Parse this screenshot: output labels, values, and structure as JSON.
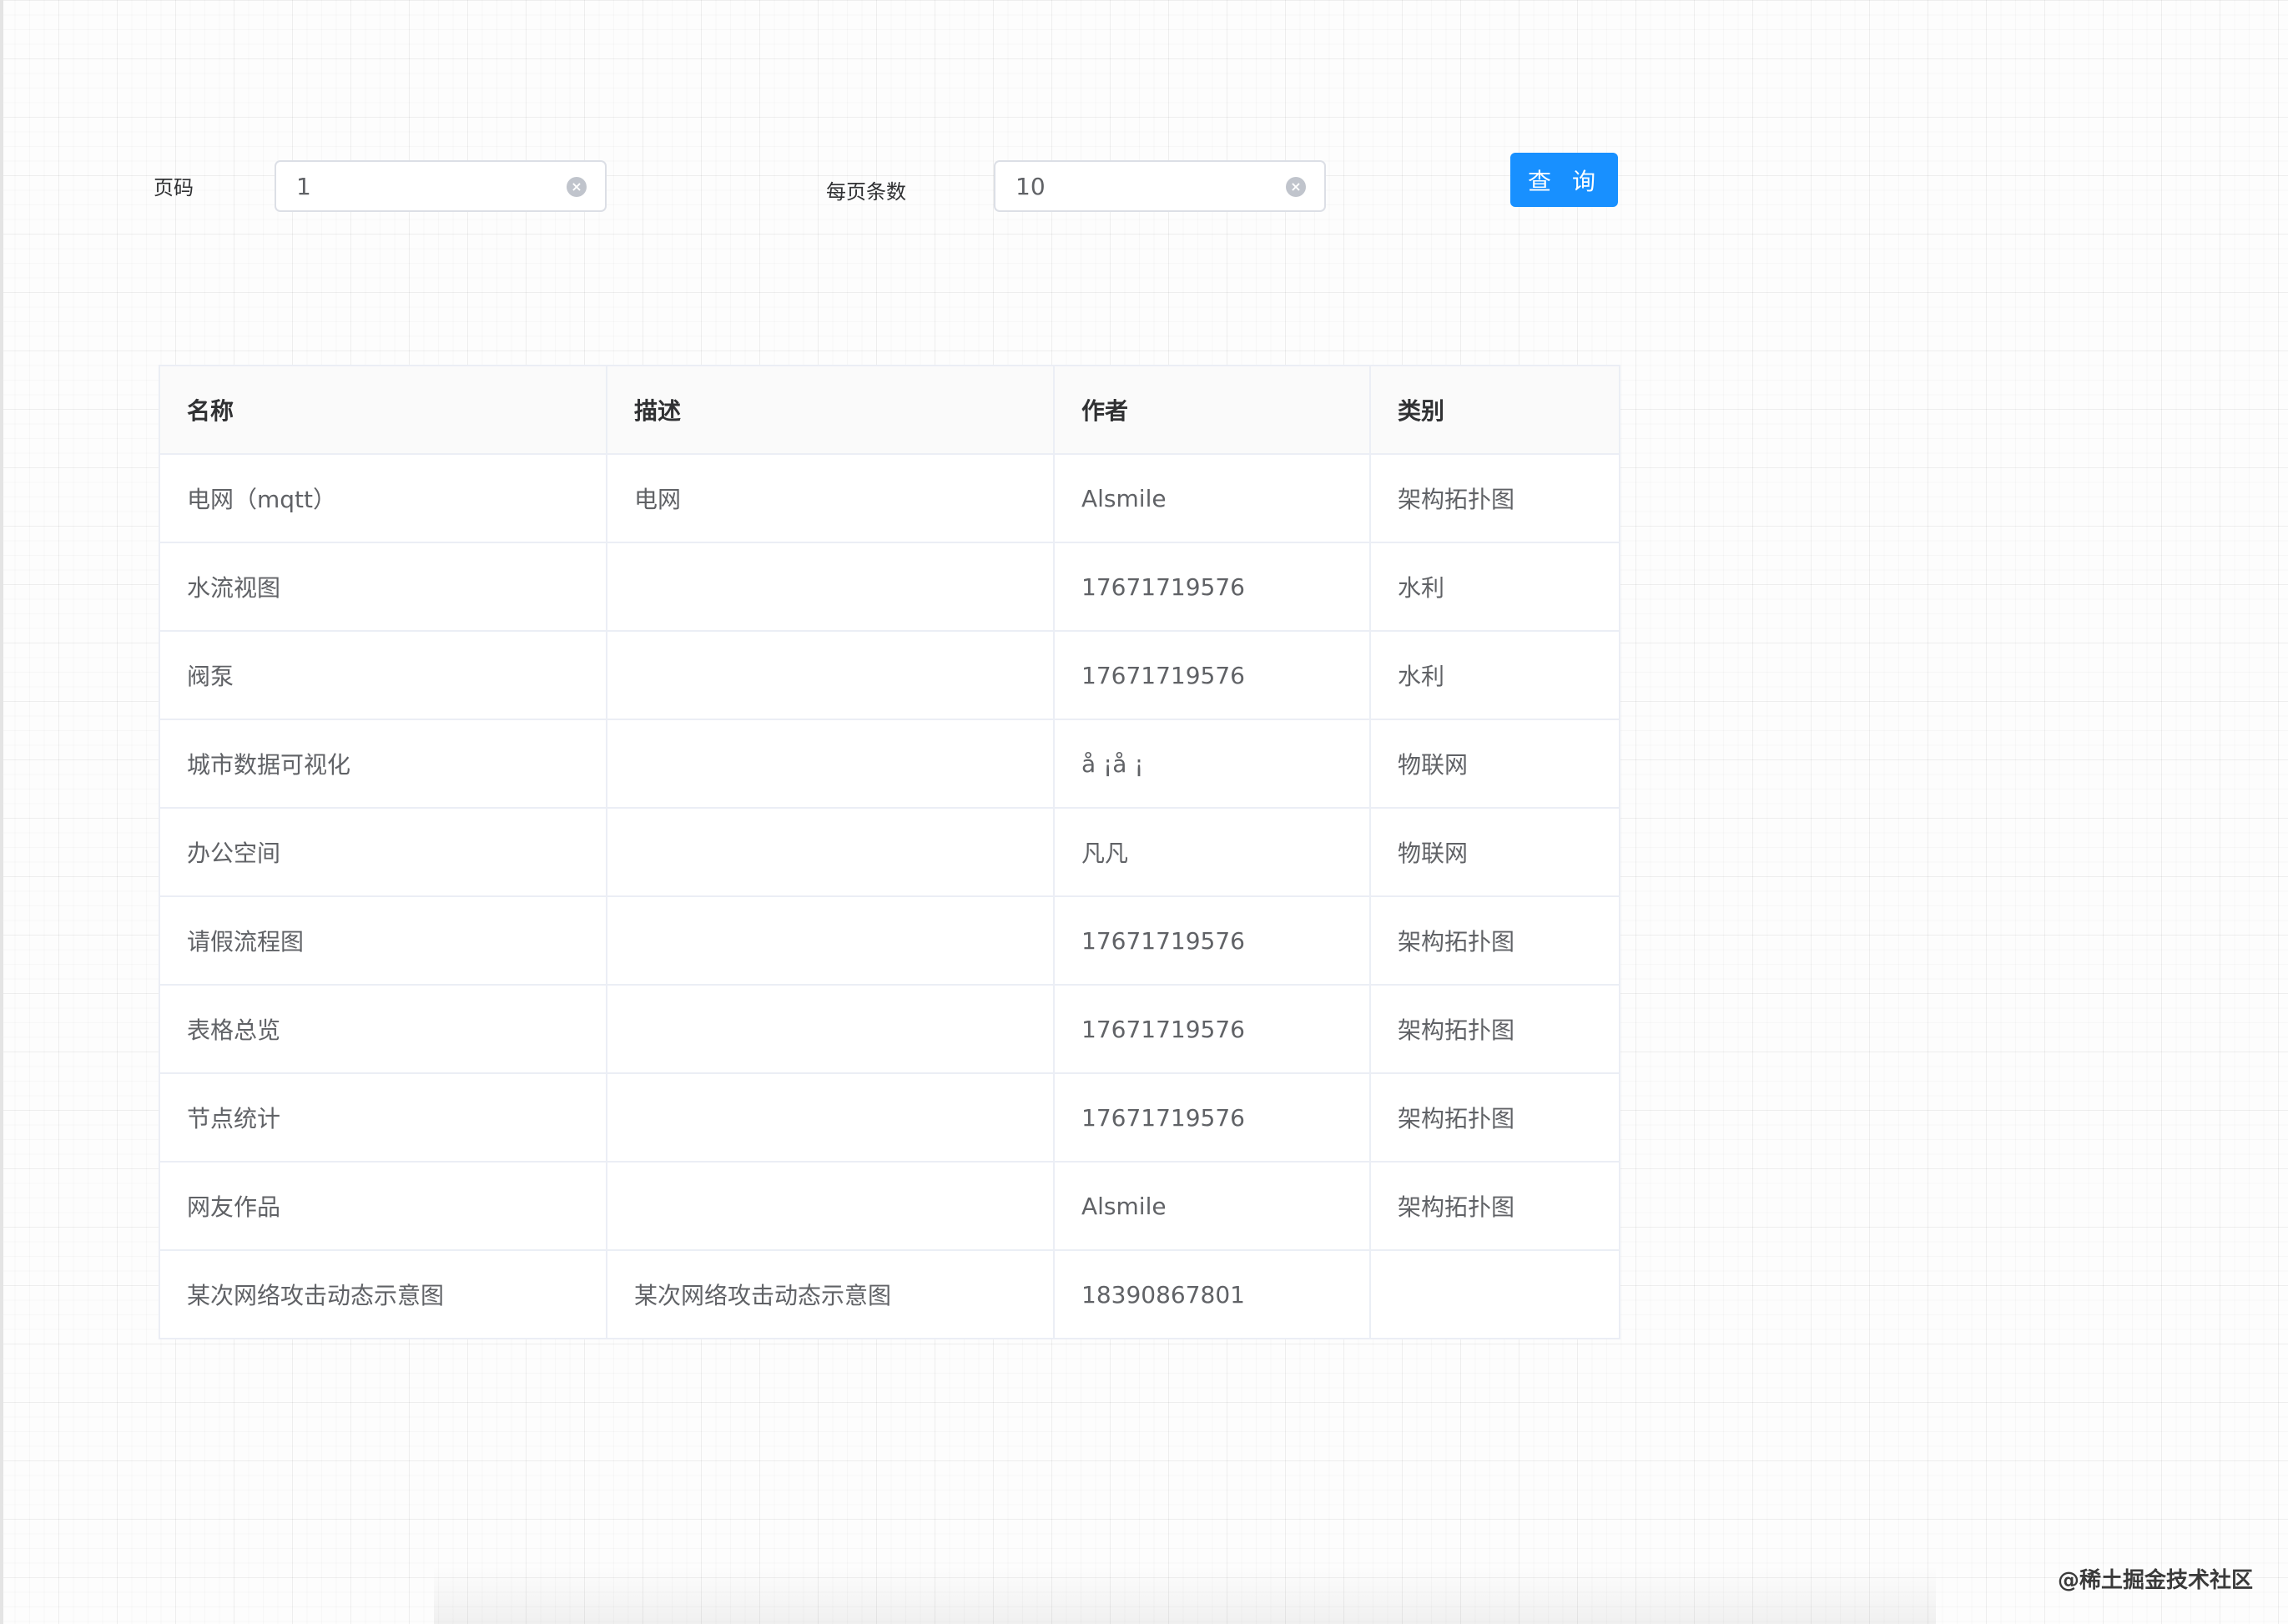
{
  "query_form": {
    "page_label": "页码",
    "page_value": "1",
    "page_size_label": "每页条数",
    "page_size_value": "10",
    "clear_icon": "circle-close-icon",
    "query_button": "查 询"
  },
  "table": {
    "columns": [
      "名称",
      "描述",
      "作者",
      "类别"
    ],
    "rows": [
      [
        "电网（mqtt）",
        "电网",
        "Alsmile",
        "架构拓扑图"
      ],
      [
        "水流视图",
        "",
        "17671719576",
        "水利"
      ],
      [
        "阀泵",
        "",
        "17671719576",
        "水利"
      ],
      [
        "城市数据可视化",
        "",
        "å ¡å ¡",
        "物联网"
      ],
      [
        "办公空间",
        "",
        "凡凡",
        "物联网"
      ],
      [
        "请假流程图",
        "",
        "17671719576",
        "架构拓扑图"
      ],
      [
        "表格总览",
        "",
        "17671719576",
        "架构拓扑图"
      ],
      [
        "节点统计",
        "",
        "17671719576",
        "架构拓扑图"
      ],
      [
        "网友作品",
        "",
        "Alsmile",
        "架构拓扑图"
      ],
      [
        "某次网络攻击动态示意图",
        "某次网络攻击动态示意图",
        "18390867801",
        ""
      ]
    ]
  },
  "watermark": "@稀土掘金技术社区",
  "colors": {
    "primary": "#1890ff",
    "border": "#ebeef5",
    "header_bg": "#fafafa",
    "text": "#606266",
    "heading": "#303133"
  }
}
